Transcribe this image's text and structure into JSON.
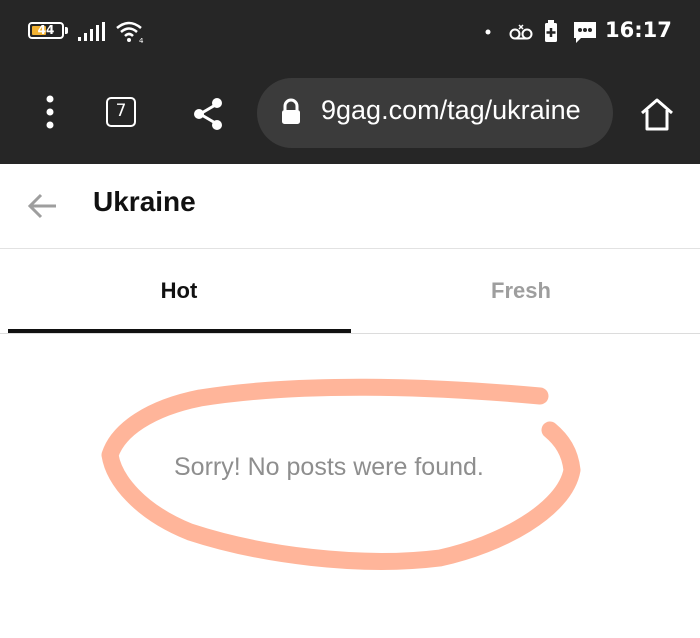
{
  "status_bar": {
    "battery_level": "44",
    "battery_fraction": 0.44,
    "time": "16:17",
    "icons": [
      "signal-icon",
      "wifi-icon",
      "dot-icon",
      "voicemail-icon",
      "battery-saver-icon",
      "message-icon"
    ]
  },
  "browser": {
    "url": "9gag.com/tag/ukraine",
    "tab_count": "7",
    "icons": [
      "menu-dots-icon",
      "share-icon",
      "lock-icon",
      "home-icon"
    ]
  },
  "page": {
    "title": "Ukraine",
    "tabs": [
      {
        "label": "Hot",
        "active": true
      },
      {
        "label": "Fresh",
        "active": false
      }
    ],
    "empty_message": "Sorry! No posts were found."
  },
  "colors": {
    "system_bar": "#262626",
    "url_field": "#3b3b3b",
    "battery_fill": "#f2b233",
    "annotation": "#ffb59a"
  }
}
